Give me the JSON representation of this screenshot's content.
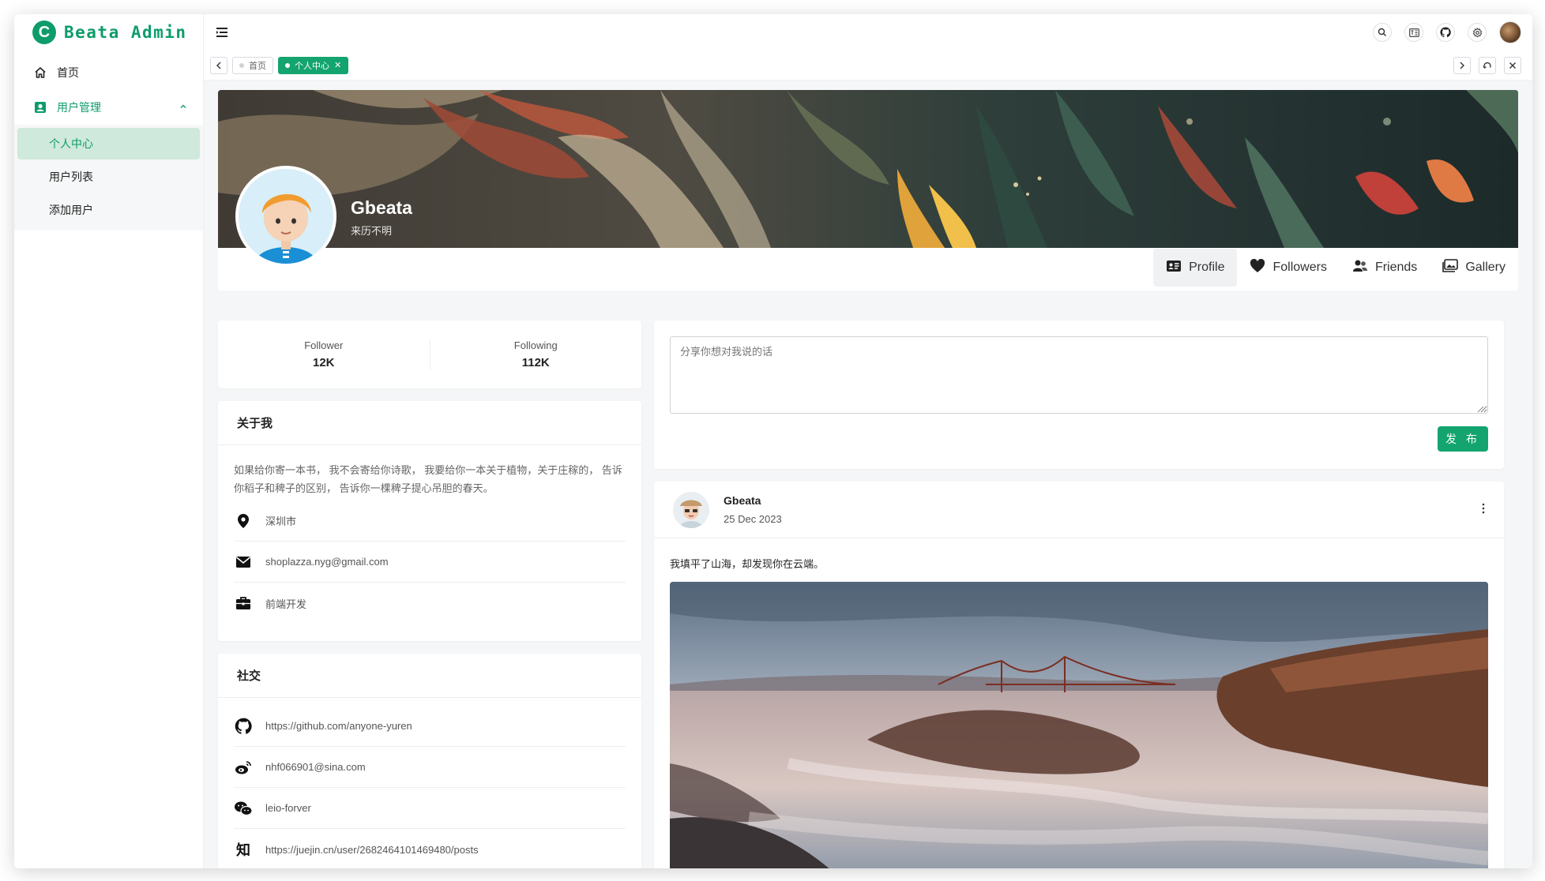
{
  "app": {
    "name": "Beata Admin",
    "logo_letter": "C"
  },
  "sidebar": {
    "home": {
      "label": "首页",
      "icon": "home-icon"
    },
    "group": {
      "label": "用户管理",
      "icon": "user-icon",
      "expanded": true
    },
    "items": [
      {
        "label": "个人中心",
        "active": true
      },
      {
        "label": "用户列表",
        "active": false
      },
      {
        "label": "添加用户",
        "active": false
      }
    ]
  },
  "header": {
    "icons": [
      "search-icon",
      "translate-icon",
      "github-icon",
      "settings-icon",
      "avatar"
    ]
  },
  "tabs": [
    {
      "label": "首页",
      "active": false,
      "closable": false
    },
    {
      "label": "个人中心",
      "active": true,
      "closable": true
    }
  ],
  "profile": {
    "name": "Gbeata",
    "subtitle": "来历不明",
    "tabs": [
      {
        "label": "Profile",
        "icon": "profile-card-icon",
        "active": true
      },
      {
        "label": "Followers",
        "icon": "heart-icon",
        "active": false
      },
      {
        "label": "Friends",
        "icon": "friends-icon",
        "active": false
      },
      {
        "label": "Gallery",
        "icon": "gallery-icon",
        "active": false
      }
    ]
  },
  "stats": [
    {
      "label": "Follower",
      "value": "12K"
    },
    {
      "label": "Following",
      "value": "112K"
    }
  ],
  "about": {
    "title": "关于我",
    "text": "如果给你寄一本书， 我不会寄给你诗歌， 我要给你一本关于植物，关于庄稼的， 告诉你稻子和稗子的区别， 告诉你一棵稗子提心吊胆的春天。",
    "location": "深圳市",
    "email": "shoplazza.nyg@gmail.com",
    "job": "前端开发"
  },
  "social": {
    "title": "社交",
    "github": "https://github.com/anyone-yuren",
    "weibo": "nhf066901@sina.com",
    "wechat": "leio-forver",
    "zhihu_glyph": "知",
    "juejin": "https://juejin.cn/user/2682464101469480/posts"
  },
  "composer": {
    "placeholder": "分享你想对我说的话",
    "submit": "发 布"
  },
  "post": {
    "author": "Gbeata",
    "date": "25 Dec 2023",
    "text": "我填平了山海，却发现你在云端。"
  },
  "colors": {
    "accent": "#13a46f",
    "brand": "#0e9c6a"
  }
}
